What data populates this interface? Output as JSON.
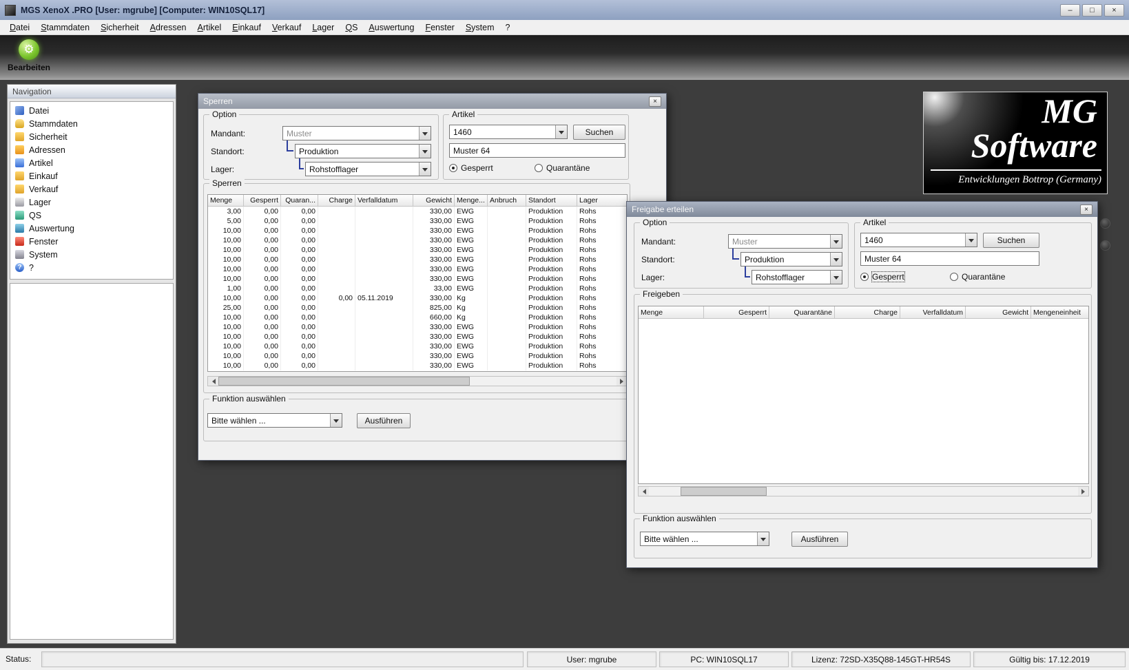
{
  "colors": {
    "titlebar_start": "#b3c0d8",
    "titlebar_end": "#8da0c0",
    "mdi_background": "#3d3d3d",
    "window_background": "#f0f0f0",
    "tree_connector": "#2c3e9e",
    "gear_green": "#7cc62e"
  },
  "app": {
    "title": "MGS XenoX .PRO [User: mgrube] [Computer: WIN10SQL17]",
    "window_controls": {
      "minimize": "–",
      "maximize": "□",
      "close": "×"
    }
  },
  "icons": {
    "close_glyph": "×"
  },
  "menubar": {
    "items": [
      "Datei",
      "Stammdaten",
      "Sicherheit",
      "Adressen",
      "Artikel",
      "Einkauf",
      "Verkauf",
      "Lager",
      "QS",
      "Auswertung",
      "Fenster",
      "System",
      "?"
    ]
  },
  "toolbar": {
    "edit": {
      "label": "Bearbeiten",
      "icon": "gear",
      "glyph": "⚙"
    }
  },
  "navigation": {
    "title": "Navigation",
    "items": [
      {
        "label": "Datei",
        "icon": "datei"
      },
      {
        "label": "Stammdaten",
        "icon": "stammdaten"
      },
      {
        "label": "Sicherheit",
        "icon": "sicherheit"
      },
      {
        "label": "Adressen",
        "icon": "adressen"
      },
      {
        "label": "Artikel",
        "icon": "artikel"
      },
      {
        "label": "Einkauf",
        "icon": "einkauf"
      },
      {
        "label": "Verkauf",
        "icon": "verkauf"
      },
      {
        "label": "Lager",
        "icon": "lager"
      },
      {
        "label": "QS",
        "icon": "qs"
      },
      {
        "label": "Auswertung",
        "icon": "auswertung"
      },
      {
        "label": "Fenster",
        "icon": "fenster"
      },
      {
        "label": "System",
        "icon": "system"
      },
      {
        "label": "?",
        "icon": "hilfe"
      }
    ]
  },
  "logo": {
    "line1": "MG",
    "line2": "Software",
    "subtitle": "Entwicklungen Bottrop (Germany)"
  },
  "sperren": {
    "title": "Sperren",
    "option_group": "Option",
    "mandant_label": "Mandant:",
    "mandant_value": "Muster",
    "standort_label": "Standort:",
    "standort_value": "Produktion",
    "lager_label": "Lager:",
    "lager_value": "Rohstofflager",
    "artikel_group": "Artikel",
    "artikel_nr": "1460",
    "suchen": "Suchen",
    "artikel_name": "Muster 64",
    "radio_gesperrt": "Gesperrt",
    "radio_quarantaene": "Quarantäne",
    "table_group": "Sperren",
    "table": {
      "headers": [
        "Menge",
        "Gesperrt",
        "Quaran...",
        "Charge",
        "Verfalldatum",
        "Gewicht",
        "Menge...",
        "Anbruch",
        "Standort",
        "Lager"
      ],
      "rows": [
        [
          "3,00",
          "0,00",
          "0,00",
          "",
          "",
          "330,00",
          "EWG",
          "",
          "Produktion",
          "Rohs"
        ],
        [
          "5,00",
          "0,00",
          "0,00",
          "",
          "",
          "330,00",
          "EWG",
          "",
          "Produktion",
          "Rohs"
        ],
        [
          "10,00",
          "0,00",
          "0,00",
          "",
          "",
          "330,00",
          "EWG",
          "",
          "Produktion",
          "Rohs"
        ],
        [
          "10,00",
          "0,00",
          "0,00",
          "",
          "",
          "330,00",
          "EWG",
          "",
          "Produktion",
          "Rohs"
        ],
        [
          "10,00",
          "0,00",
          "0,00",
          "",
          "",
          "330,00",
          "EWG",
          "",
          "Produktion",
          "Rohs"
        ],
        [
          "10,00",
          "0,00",
          "0,00",
          "",
          "",
          "330,00",
          "EWG",
          "",
          "Produktion",
          "Rohs"
        ],
        [
          "10,00",
          "0,00",
          "0,00",
          "",
          "",
          "330,00",
          "EWG",
          "",
          "Produktion",
          "Rohs"
        ],
        [
          "10,00",
          "0,00",
          "0,00",
          "",
          "",
          "330,00",
          "EWG",
          "",
          "Produktion",
          "Rohs"
        ],
        [
          "1,00",
          "0,00",
          "0,00",
          "",
          "",
          "33,00",
          "EWG",
          "",
          "Produktion",
          "Rohs"
        ],
        [
          "10,00",
          "0,00",
          "0,00",
          "0,00",
          "05.11.2019",
          "330,00",
          "Kg",
          "",
          "Produktion",
          "Rohs"
        ],
        [
          "25,00",
          "0,00",
          "0,00",
          "",
          "",
          "825,00",
          "Kg",
          "",
          "Produktion",
          "Rohs"
        ],
        [
          "10,00",
          "0,00",
          "0,00",
          "",
          "",
          "660,00",
          "Kg",
          "",
          "Produktion",
          "Rohs"
        ],
        [
          "10,00",
          "0,00",
          "0,00",
          "",
          "",
          "330,00",
          "EWG",
          "",
          "Produktion",
          "Rohs"
        ],
        [
          "10,00",
          "0,00",
          "0,00",
          "",
          "",
          "330,00",
          "EWG",
          "",
          "Produktion",
          "Rohs"
        ],
        [
          "10,00",
          "0,00",
          "0,00",
          "",
          "",
          "330,00",
          "EWG",
          "",
          "Produktion",
          "Rohs"
        ],
        [
          "10,00",
          "0,00",
          "0,00",
          "",
          "",
          "330,00",
          "EWG",
          "",
          "Produktion",
          "Rohs"
        ],
        [
          "10,00",
          "0,00",
          "0,00",
          "",
          "",
          "330,00",
          "EWG",
          "",
          "Produktion",
          "Rohs"
        ]
      ]
    },
    "funktion_group": "Funktion auswählen",
    "funktion_value": "Bitte wählen ...",
    "ausfuehren": "Ausführen"
  },
  "freigabe": {
    "title": "Freigabe erteilen",
    "option_group": "Option",
    "mandant_label": "Mandant:",
    "mandant_value": "Muster",
    "standort_label": "Standort:",
    "standort_value": "Produktion",
    "lager_label": "Lager:",
    "lager_value": "Rohstofflager",
    "artikel_group": "Artikel",
    "artikel_nr": "1460",
    "suchen": "Suchen",
    "artikel_name": "Muster 64",
    "radio_gesperrt": "Gesperrt",
    "radio_quarantaene": "Quarantäne",
    "freigeben_group": "Freigeben",
    "table": {
      "headers": [
        "Menge",
        "Gesperrt",
        "Quarantäne",
        "Charge",
        "Verfalldatum",
        "Gewicht",
        "Mengeneinheit"
      ],
      "rows": []
    },
    "funktion_group": "Funktion auswählen",
    "funktion_value": "Bitte wählen ...",
    "ausfuehren": "Ausführen"
  },
  "statusbar": {
    "status_label": "Status:",
    "user": "User: mgrube",
    "pc": "PC: WIN10SQL17",
    "lizenz": "Lizenz: 72SD-X35Q88-145GT-HR54S",
    "gueltig": "Gültig bis: 17.12.2019"
  }
}
